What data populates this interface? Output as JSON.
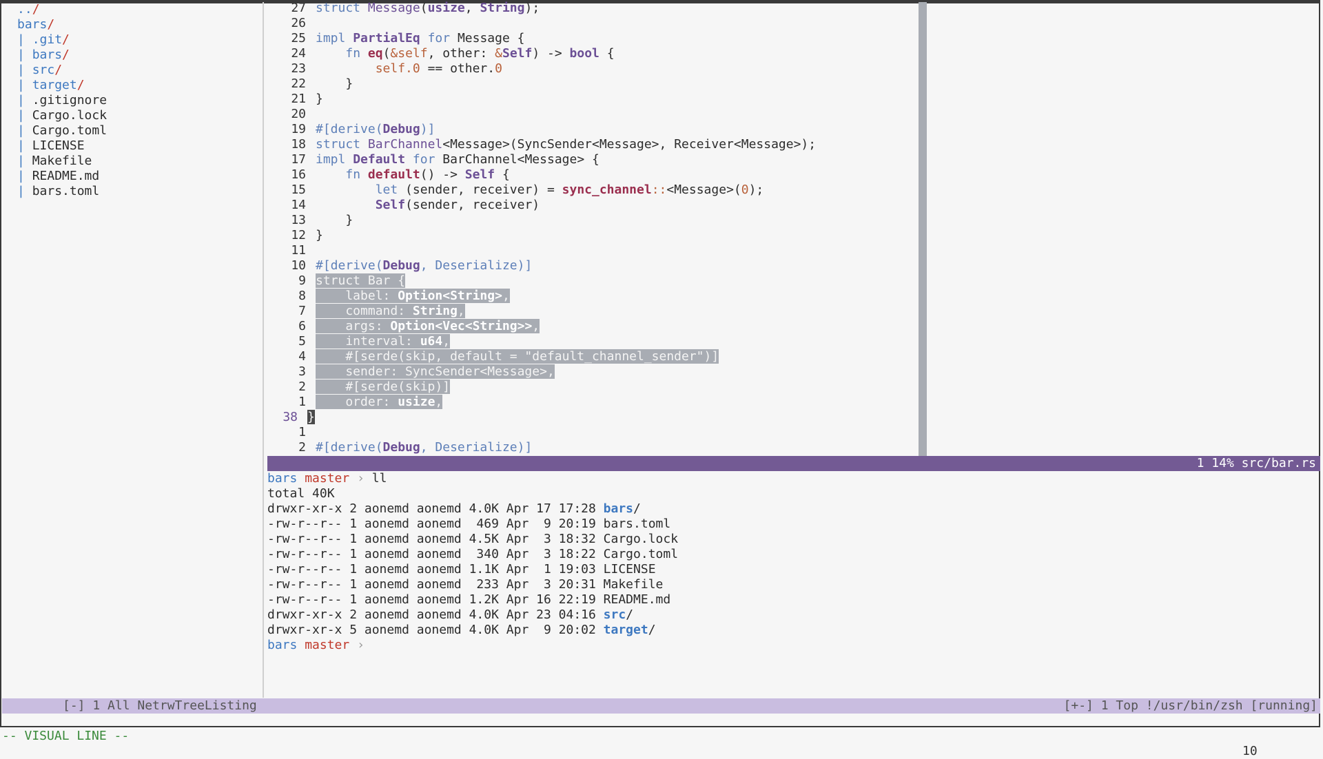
{
  "tree": {
    "items": [
      {
        "prefix": "",
        "name": "../",
        "dir": true
      },
      {
        "prefix": "",
        "name": "bars/",
        "dir": true
      },
      {
        "prefix": "| ",
        "name": ".git/",
        "dir": true
      },
      {
        "prefix": "| ",
        "name": "bars/",
        "dir": true
      },
      {
        "prefix": "| ",
        "name": "src/",
        "dir": true
      },
      {
        "prefix": "| ",
        "name": "target/",
        "dir": true
      },
      {
        "prefix": "| ",
        "name": ".gitignore",
        "dir": false
      },
      {
        "prefix": "| ",
        "name": "Cargo.lock",
        "dir": false
      },
      {
        "prefix": "| ",
        "name": "Cargo.toml",
        "dir": false
      },
      {
        "prefix": "| ",
        "name": "LICENSE",
        "dir": false
      },
      {
        "prefix": "| ",
        "name": "Makefile",
        "dir": false
      },
      {
        "prefix": "| ",
        "name": "README.md",
        "dir": false
      },
      {
        "prefix": "| ",
        "name": "bars.toml",
        "dir": false
      }
    ]
  },
  "editor": {
    "lines": [
      {
        "ln": "27",
        "html": "<span class=\"kw\">struct</span> <span class=\"tyn\">Message</span>(<span class=\"ty\">usize</span>, <span class=\"ty\">String</span>);"
      },
      {
        "ln": "26",
        "html": ""
      },
      {
        "ln": "25",
        "html": "<span class=\"kw\">impl</span> <span class=\"ty\">PartialEq</span> <span class=\"kw\">for</span> Message {"
      },
      {
        "ln": "24",
        "html": "    <span class=\"kw\">fn</span> <span class=\"fn\">eq</span>(<span class=\"sl\">&amp;self</span>, other: <span class=\"sl\">&amp;</span><span class=\"ty\">Self</span>) -&gt; <span class=\"ty\">bool</span> {"
      },
      {
        "ln": "23",
        "html": "        <span class=\"sl\">self.0</span> == other.<span class=\"num\">0</span>"
      },
      {
        "ln": "22",
        "html": "    }"
      },
      {
        "ln": "21",
        "html": "}"
      },
      {
        "ln": "20",
        "html": ""
      },
      {
        "ln": "19",
        "html": "<span class=\"attr\">#[derive(</span><span class=\"ty\">Debug</span><span class=\"attr\">)]</span>"
      },
      {
        "ln": "18",
        "html": "<span class=\"kw\">struct</span> <span class=\"tyn\">BarChannel</span>&lt;Message&gt;(SyncSender&lt;Message&gt;, Receiver&lt;Message&gt;);"
      },
      {
        "ln": "17",
        "html": "<span class=\"kw\">impl</span> <span class=\"ty\">Default</span> <span class=\"kw\">for</span> BarChannel&lt;Message&gt; {"
      },
      {
        "ln": "16",
        "html": "    <span class=\"kw\">fn</span> <span class=\"fn\">default</span>() -&gt; <span class=\"ty\">Self</span> {"
      },
      {
        "ln": "15",
        "html": "        <span class=\"kw\">let</span> (sender, receiver) = <span class=\"fn\">sync_channel</span><span class=\"sl\">::</span>&lt;Message&gt;(<span class=\"num\">0</span>);"
      },
      {
        "ln": "14",
        "html": "        <span class=\"ty\">Self</span>(sender, receiver)"
      },
      {
        "ln": "13",
        "html": "    }"
      },
      {
        "ln": "12",
        "html": "}"
      },
      {
        "ln": "11",
        "html": ""
      },
      {
        "ln": "10",
        "html": "<span class=\"attr\">#[derive(</span><span class=\"ty\">Debug</span><span class=\"attr\">, Deserialize)]</span>"
      },
      {
        "ln": "9",
        "html": "<span class=\"sel\">struct Bar {</span>"
      },
      {
        "ln": "8",
        "html": "<span class=\"sel\">    label: <span class=\"ty\">Option&lt;String&gt;</span>,</span>"
      },
      {
        "ln": "7",
        "html": "<span class=\"sel\">    command: <span class=\"ty\">String</span>,</span>"
      },
      {
        "ln": "6",
        "html": "<span class=\"sel\">    args: <span class=\"ty\">Option&lt;Vec&lt;String&gt;&gt;</span>,</span>"
      },
      {
        "ln": "5",
        "html": "<span class=\"sel\">    interval: <span class=\"ty\">u64</span>,</span>"
      },
      {
        "ln": "4",
        "html": "<span class=\"sel\">    #[serde(skip, default = \"default_channel_sender\")]</span>"
      },
      {
        "ln": "3",
        "html": "<span class=\"sel\">    sender: SyncSender&lt;Message&gt;,</span>"
      },
      {
        "ln": "2",
        "html": "<span class=\"sel\">    #[serde(skip)]</span>"
      },
      {
        "ln": "1",
        "html": "<span class=\"sel\">    order: <span class=\"ty\">usize</span>,</span>"
      },
      {
        "ln": "38",
        "cur": true,
        "html": "<span class=\"cursor\">}</span>"
      },
      {
        "ln": "1",
        "html": ""
      },
      {
        "ln": "2",
        "html": "<span class=\"attr\">#[derive(</span><span class=\"ty\">Debug</span><span class=\"attr\">, Deserialize)]</span>"
      }
    ],
    "status": "1 14% src/bar.rs"
  },
  "terminal": {
    "prompt_dir": "bars",
    "prompt_branch": "master",
    "prompt_arrow": "›",
    "command": "ll",
    "total": "total 40K",
    "rows": [
      {
        "meta": "drwxr-xr-x 2 aonemd aonemd 4.0K Apr 17 17:28 ",
        "name": "bars",
        "dir": true
      },
      {
        "meta": "-rw-r--r-- 1 aonemd aonemd  469 Apr  9 20:19 ",
        "name": "bars.toml",
        "dir": false
      },
      {
        "meta": "-rw-r--r-- 1 aonemd aonemd 4.5K Apr  3 18:32 ",
        "name": "Cargo.lock",
        "dir": false
      },
      {
        "meta": "-rw-r--r-- 1 aonemd aonemd  340 Apr  3 18:22 ",
        "name": "Cargo.toml",
        "dir": false
      },
      {
        "meta": "-rw-r--r-- 1 aonemd aonemd 1.1K Apr  1 19:03 ",
        "name": "LICENSE",
        "dir": false
      },
      {
        "meta": "-rw-r--r-- 1 aonemd aonemd  233 Apr  3 20:31 ",
        "name": "Makefile",
        "dir": false
      },
      {
        "meta": "-rw-r--r-- 1 aonemd aonemd 1.2K Apr 16 22:19 ",
        "name": "README.md",
        "dir": false
      },
      {
        "meta": "drwxr-xr-x 2 aonemd aonemd 4.0K Apr 23 04:16 ",
        "name": "src",
        "dir": true
      },
      {
        "meta": "drwxr-xr-x 5 aonemd aonemd 4.0K Apr  9 20:02 ",
        "name": "target",
        "dir": true
      }
    ]
  },
  "statusline": {
    "left": "[-] 1 All NetrwTreeListing",
    "right": "[+-] 1 Top !/usr/bin/zsh [running]"
  },
  "cmdline": {
    "mode": "-- VISUAL LINE --",
    "count": "10"
  },
  "colors": {
    "status_active": "#735a94",
    "status_inactive": "#c9bde0",
    "selection": "#a8acb3",
    "directory": "#3d78c0"
  }
}
